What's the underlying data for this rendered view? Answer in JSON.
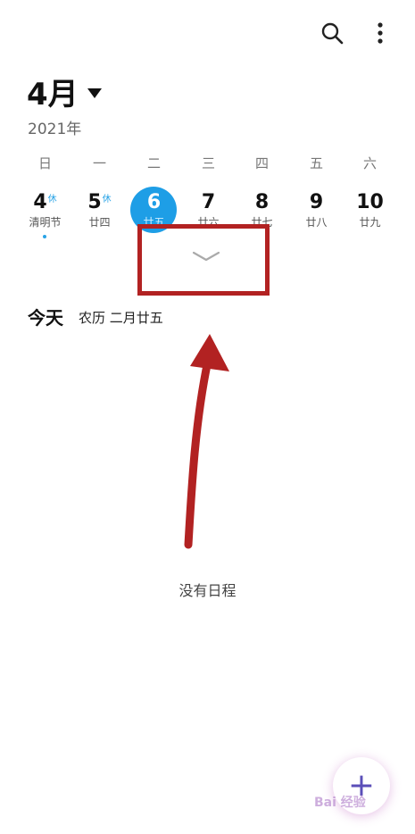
{
  "header": {
    "month": "4月",
    "year": "2021年",
    "search_icon": "search-icon",
    "more_icon": "more-vertical-icon"
  },
  "week": {
    "weekdays": [
      "日",
      "一",
      "二",
      "三",
      "四",
      "五",
      "六"
    ],
    "days": [
      {
        "day": "4",
        "rest": "休",
        "sub": "清明节"
      },
      {
        "day": "5",
        "rest": "休",
        "sub": "廿四"
      },
      {
        "day": "6",
        "rest": "",
        "sub": "廿五"
      },
      {
        "day": "7",
        "rest": "",
        "sub": "廿六"
      },
      {
        "day": "8",
        "rest": "",
        "sub": "廿七"
      },
      {
        "day": "9",
        "rest": "",
        "sub": "廿八"
      },
      {
        "day": "10",
        "rest": "",
        "sub": "廿九"
      }
    ],
    "selected_index": 2,
    "selected_color": "#1e9ee6",
    "expand_icon": "chevron-down-icon"
  },
  "today": {
    "label": "今天",
    "lunar": "农历 二月廿五"
  },
  "empty_state": "没有日程",
  "fab_icon": "plus-icon",
  "annotation": {
    "color": "#b22222"
  },
  "watermark_text": "Bai 经验"
}
